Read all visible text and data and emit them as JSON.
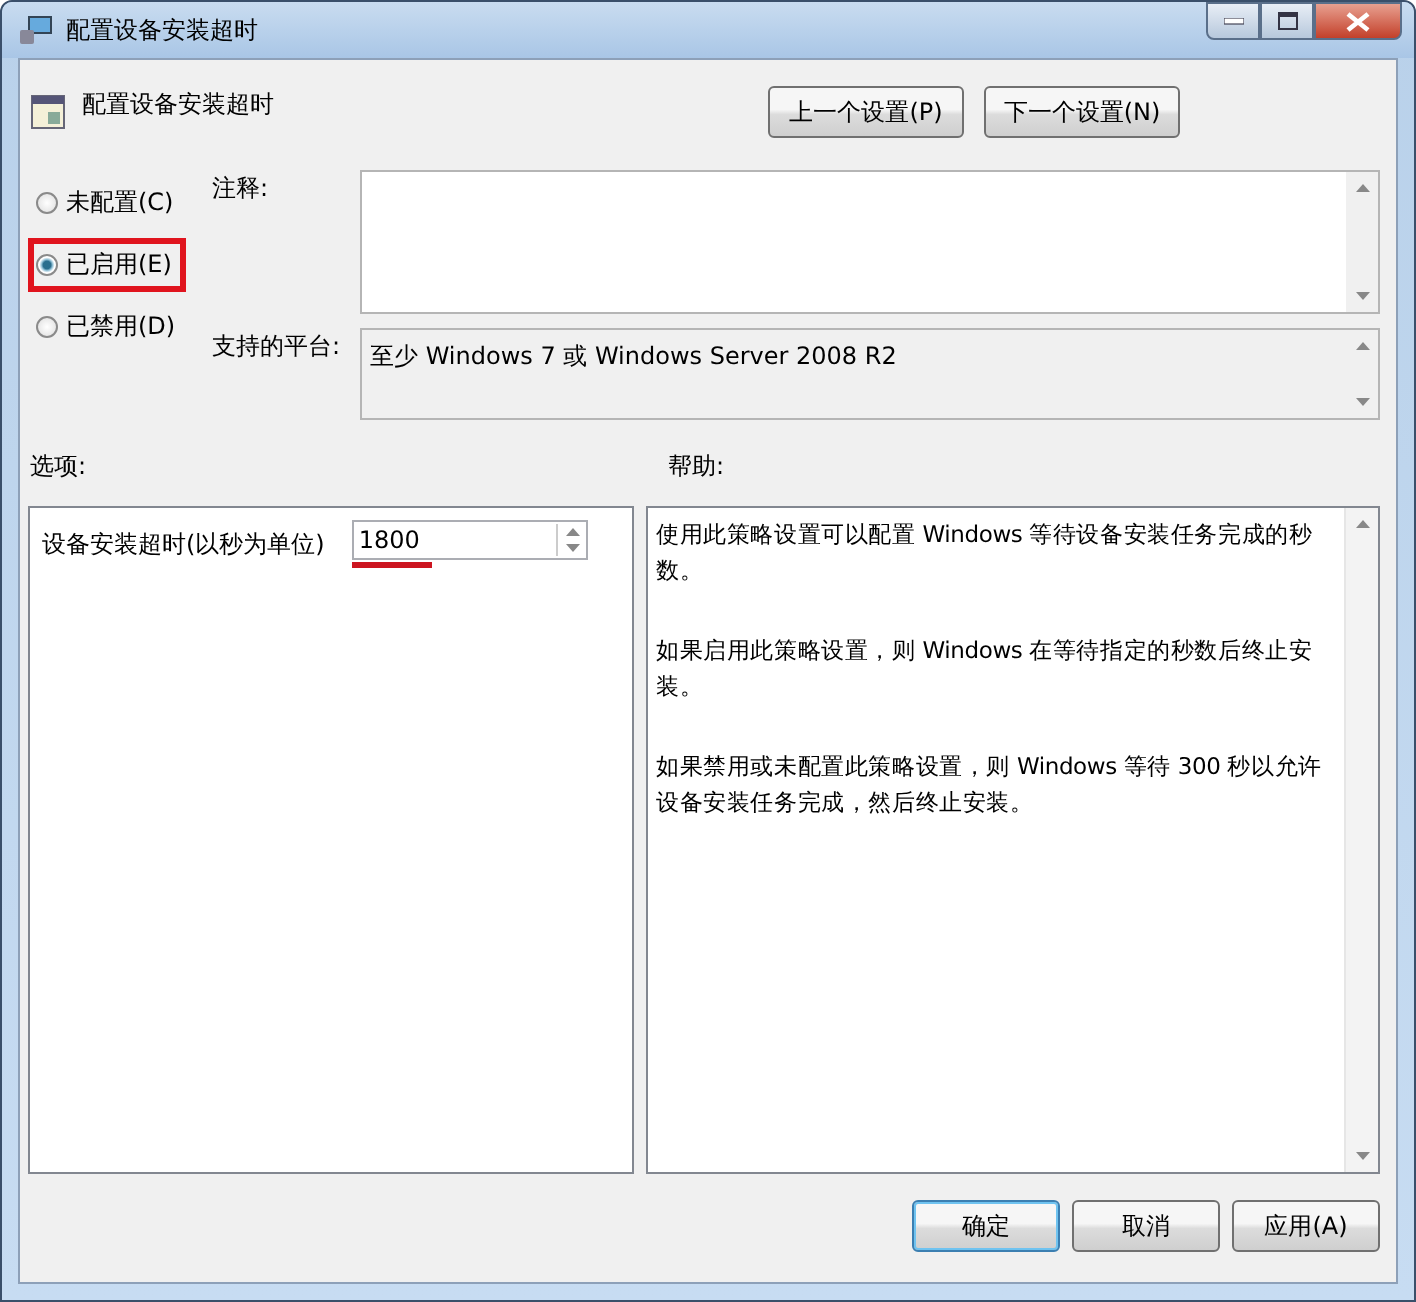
{
  "window": {
    "title": "配置设备安装超时"
  },
  "policy": {
    "title": "配置设备安装超时"
  },
  "nav_buttons": [
    "上一个设置(P)",
    "下一个设置(N)"
  ],
  "state_options": [
    {
      "label": "未配置(C)",
      "selected": false,
      "highlighted": false
    },
    {
      "label": "已启用(E)",
      "selected": true,
      "highlighted": true
    },
    {
      "label": "已禁用(D)",
      "selected": false,
      "highlighted": false
    }
  ],
  "comment": {
    "label": "注释:"
  },
  "platform": {
    "label": "支持的平台:",
    "value": "至少 Windows 7 或 Windows Server 2008 R2"
  },
  "options": {
    "heading": "选项:",
    "setting": {
      "label": "设备安装超时(以秒为单位)",
      "value": "1800",
      "underlined": true
    }
  },
  "help": {
    "heading": "帮助:",
    "paragraphs": [
      "使用此策略设置可以配置 Windows 等待设备安装任务完成的秒数。",
      "如果启用此策略设置，则 Windows 在等待指定的秒数后终止安装。",
      "如果禁用或未配置此策略设置，则 Windows 等待 300 秒以允许设备安装任务完成，然后终止安装。"
    ]
  },
  "buttons": [
    "确定",
    "取消",
    "应用(A)"
  ]
}
